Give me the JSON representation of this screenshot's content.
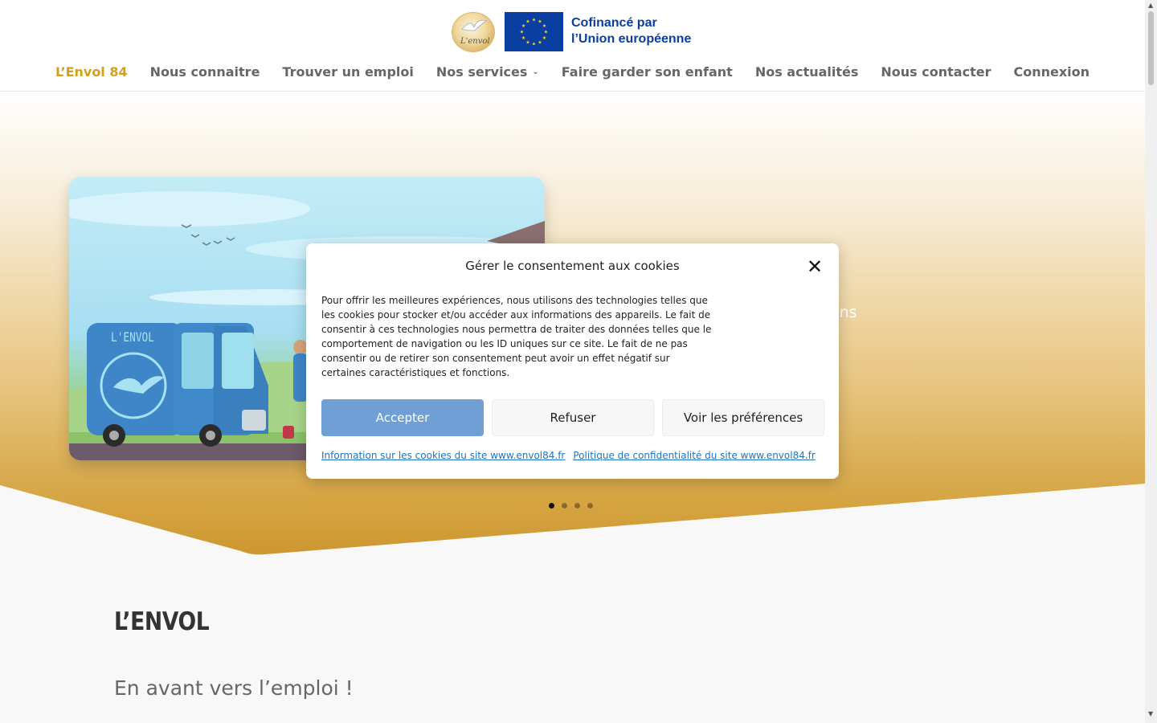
{
  "header": {
    "logo_text": "L'envol",
    "eu_line1": "Cofinancé par",
    "eu_line2": "l’Union européenne"
  },
  "nav": {
    "items": [
      {
        "label": "L’Envol 84",
        "active": true
      },
      {
        "label": "Nous connaitre"
      },
      {
        "label": "Trouver un emploi"
      },
      {
        "label": "Nos services",
        "has_dropdown": true
      },
      {
        "label": "Faire garder son enfant"
      },
      {
        "label": "Nos actualités"
      },
      {
        "label": "Nous contacter"
      },
      {
        "label": "Connexion"
      }
    ],
    "active_color": "#d4a01c"
  },
  "hero": {
    "van_label": "L'ENVOL",
    "partial_text": "ans",
    "slides_count": 4,
    "active_slide": 1
  },
  "cookie": {
    "title": "Gérer le consentement aux cookies",
    "body": "Pour offrir les meilleures expériences, nous utilisons des technologies telles que les cookies pour stocker et/ou accéder aux informations des appareils. Le fait de consentir à ces technologies nous permettra de traiter des données telles que le comportement de navigation ou les ID uniques sur ce site. Le fait de ne pas consentir ou de retirer son consentement peut avoir un effet négatif sur certaines caractéristiques et fonctions.",
    "accept_label": "Accepter",
    "refuse_label": "Refuser",
    "prefs_label": "Voir les préférences",
    "link_cookies": "Information sur les cookies du site www.envol84.fr",
    "link_privacy": "Politique de confidentialité du site www.envol84.fr",
    "accept_color": "#6f9fd4"
  },
  "content": {
    "brand_title": "L’ENVOL",
    "tagline": "En avant vers l’emploi !"
  }
}
